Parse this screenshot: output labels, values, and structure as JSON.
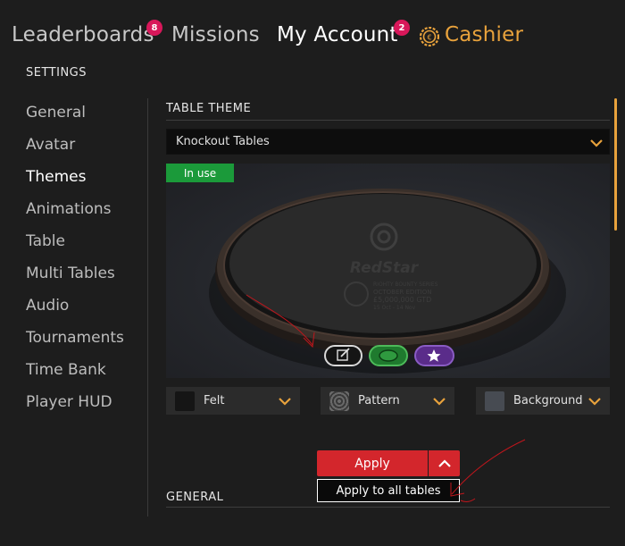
{
  "topnav": {
    "leaderboards": "Leaderboards",
    "leaderboards_badge": "8",
    "missions": "Missions",
    "my_account": "My Account",
    "my_account_badge": "2",
    "cashier": "Cashier"
  },
  "settings_title": "SETTINGS",
  "sidebar": {
    "items": [
      {
        "label": "General"
      },
      {
        "label": "Avatar"
      },
      {
        "label": "Themes"
      },
      {
        "label": "Animations"
      },
      {
        "label": "Table"
      },
      {
        "label": "Multi Tables"
      },
      {
        "label": "Audio"
      },
      {
        "label": "Tournaments"
      },
      {
        "label": "Time Bank"
      },
      {
        "label": "Player HUD"
      }
    ]
  },
  "table_theme": {
    "title": "TABLE THEME",
    "selected": "Knockout Tables",
    "in_use": "In use",
    "table_logo": "RedStar",
    "table_text": [
      "RIOHTY BOUNTY SERIES",
      "OCTOBER EDITION",
      "£5,000,000 GTD",
      "15 Oct - 14 Nov"
    ]
  },
  "dropdowns": {
    "felt": "Felt",
    "pattern": "Pattern",
    "background": "Background"
  },
  "apply": {
    "label": "Apply",
    "apply_all": "Apply to all tables"
  },
  "general_title": "GENERAL",
  "colors": {
    "accent": "#e8a23c",
    "apply_red": "#d3262c",
    "in_use_green": "#1b9a3a",
    "badge_pink": "#d8175a"
  }
}
